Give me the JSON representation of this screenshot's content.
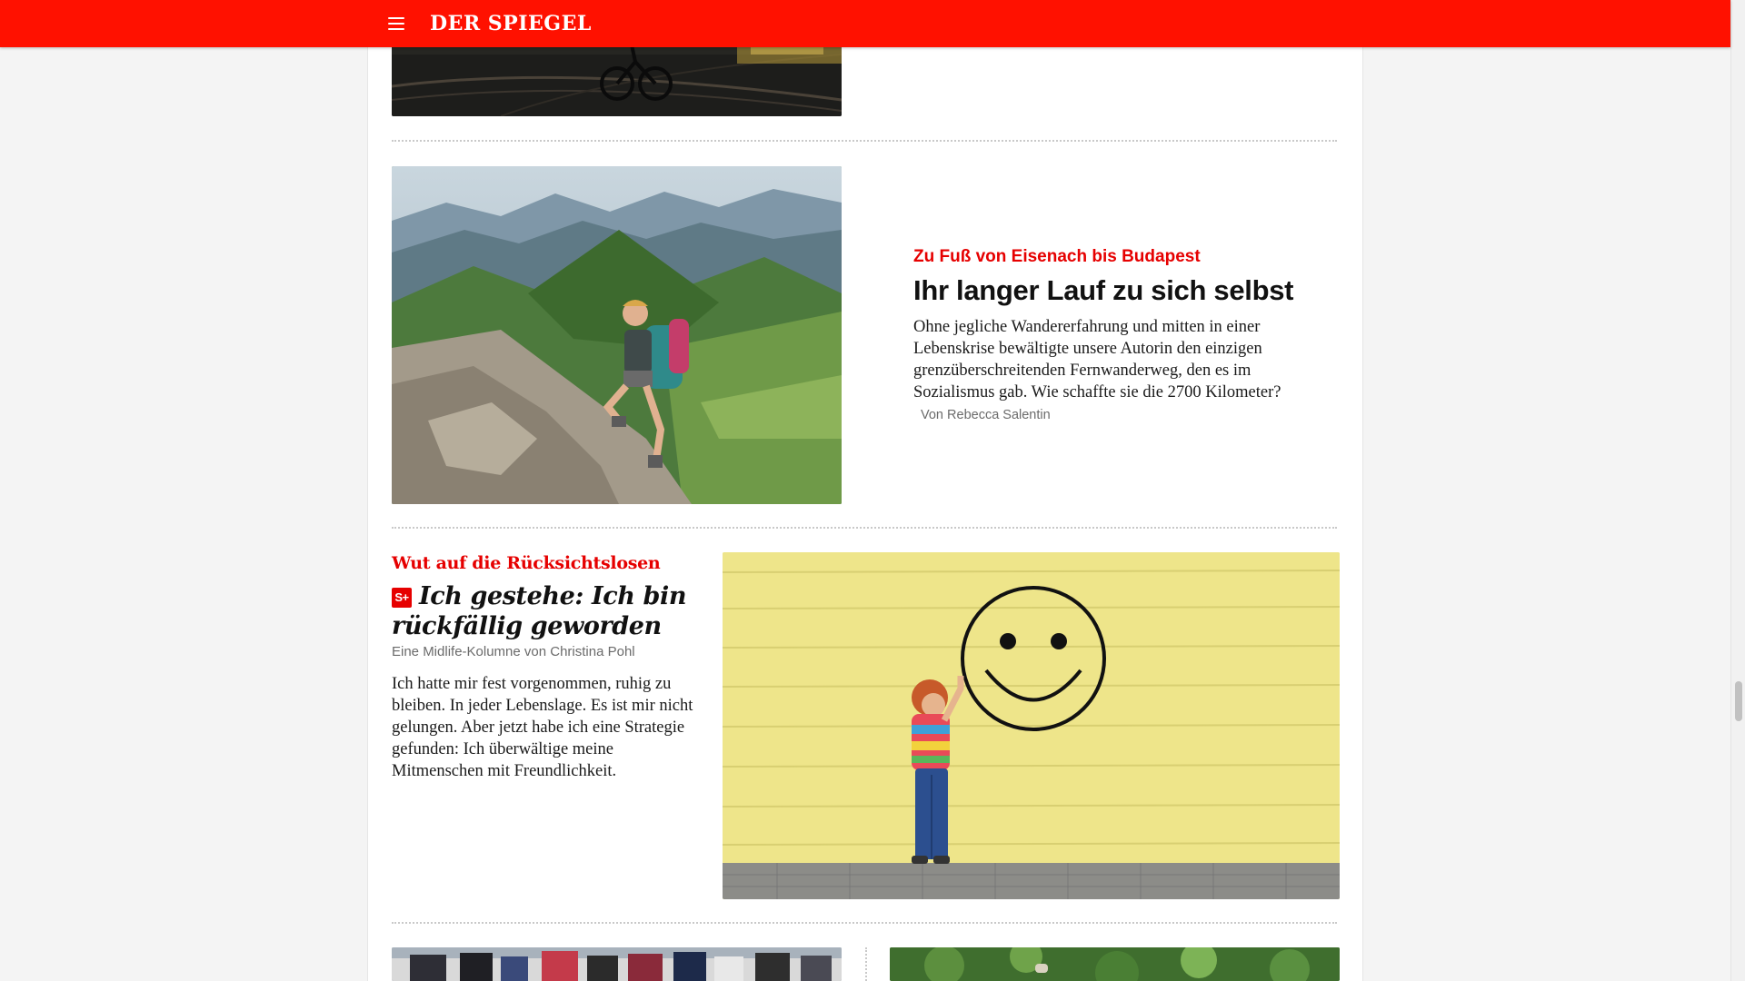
{
  "header": {
    "logo": "DER SPIEGEL",
    "menu_icon": "hamburger-menu-icon",
    "background_color": "#ff1100"
  },
  "articles": [
    {
      "kicker": "Zu Fuß von Eisenach bis Budapest",
      "title": "Ihr langer Lauf zu sich selbst",
      "teaser": "Ohne jegliche Wandererfahrung und mitten in einer Lebenskrise bewältigte unsere Autorin den einzigen grenzüberschreitenden Fernwanderweg, den es im Sozialismus gab. Wie schaffte sie die 2700 Kilometer?",
      "byline": "Von Rebecca Salentin"
    },
    {
      "kicker": "Wut auf die Rücksichtslosen",
      "badge": "S+",
      "title": "Ich gestehe: Ich bin rückfällig geworden",
      "byline": "Eine Midlife-Kolumne von Christina Pohl",
      "teaser": "Ich hatte mir fest vorgenommen, ruhig zu bleiben. In jeder Lebenslage. Es ist mir nicht gelungen. Aber jetzt habe ich eine Strategie gefunden: Ich überwältige meine Mitmenschen mit Freundlichkeit."
    }
  ],
  "colors": {
    "accent": "#e60000",
    "text": "#111111",
    "meta": "#6b6b6b"
  }
}
